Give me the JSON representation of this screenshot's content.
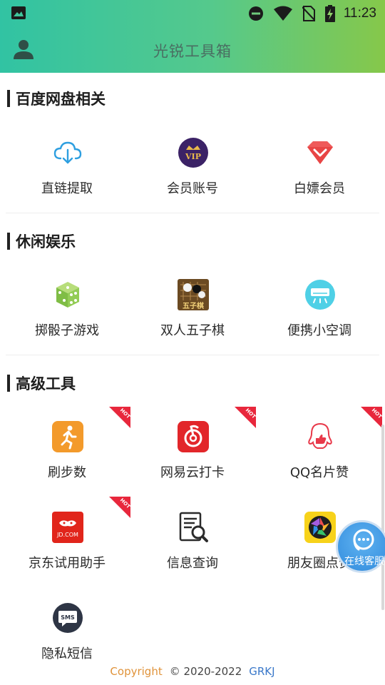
{
  "status_bar": {
    "time": "11:23"
  },
  "app": {
    "title": "光锐工具箱"
  },
  "sections": [
    {
      "title": "百度网盘相关",
      "items": [
        {
          "label": "直链提取",
          "icon": "cloud-download-icon"
        },
        {
          "label": "会员账号",
          "icon": "vip-crown-icon"
        },
        {
          "label": "白嫖会员",
          "icon": "diamond-icon"
        }
      ]
    },
    {
      "title": "休闲娱乐",
      "items": [
        {
          "label": "掷骰子游戏",
          "icon": "dice-icon"
        },
        {
          "label": "双人五子棋",
          "icon": "gomoku-icon",
          "icon_text": "五子棋"
        },
        {
          "label": "便携小空调",
          "icon": "air-conditioner-icon"
        }
      ]
    },
    {
      "title": "高级工具",
      "items": [
        {
          "label": "刷步数",
          "icon": "running-icon",
          "hot": true
        },
        {
          "label": "网易云打卡",
          "icon": "netease-music-icon",
          "hot": true
        },
        {
          "label": "QQ名片赞",
          "icon": "qq-like-icon",
          "hot": true
        },
        {
          "label": "京东试用助手",
          "icon": "jd-icon",
          "icon_text": "JD.COM",
          "hot": true
        },
        {
          "label": "信息查询",
          "icon": "document-search-icon"
        },
        {
          "label": "朋友圈点赞",
          "icon": "camera-aperture-icon"
        },
        {
          "label": "隐私短信",
          "icon": "sms-icon",
          "icon_text": "SMS"
        }
      ]
    }
  ],
  "hot_badge": "HOT",
  "customer_service": {
    "label": "在线客服"
  },
  "footer": {
    "copyright_word": "Copyright",
    "years": "© 2020-2022",
    "brand": "GRKJ"
  },
  "colors": {
    "header_gradient": [
      "#31c3a3",
      "#86c84a"
    ],
    "hot_badge": "#e8273c",
    "cs_bubble": "#3f97e3",
    "footer_copyright": "#e0933a",
    "footer_brand": "#3a78c9"
  }
}
